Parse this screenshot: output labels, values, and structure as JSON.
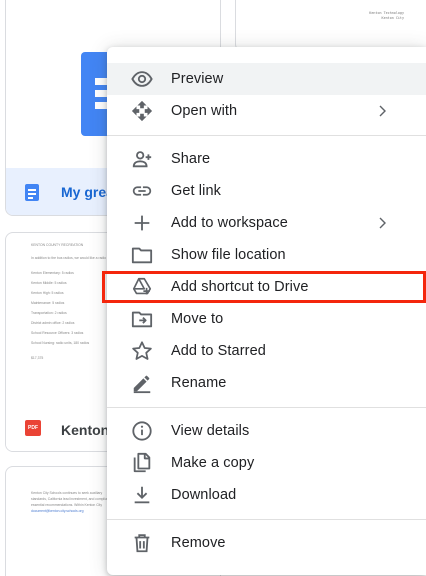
{
  "files": [
    {
      "title": "My grea",
      "type": "doc"
    },
    {
      "title": "Kenton S",
      "type": "pdf",
      "badge": "PDF"
    }
  ],
  "thumbnails": {
    "card2_lines": [
      "Kenton Technology",
      "Kenton City"
    ],
    "card3_lines": [
      "KENTON COUNTY RECREATION",
      "In addition to the bus radios, we would like a radio for",
      "Kenton Elementary: 5 radios",
      "Kenton Middle: 5 radios",
      "Kenton High: 5 radios",
      "Maintenance: 5 radios",
      "Transportation: 2 radios",
      "District admin office: 2 radios",
      "School Resource Officers: 3 radios",
      "School Nursing: radio units, 180 radios",
      "$17,375"
    ],
    "card4_lines": [
      "Kenton City Schools continues to seek auxiliary",
      "standards, California lead investment, and compliance",
      "essential recommendations. Within Kenton City",
      "document@kenton.city.schools.org"
    ]
  },
  "menu": {
    "items": [
      {
        "label": "Preview",
        "icon": "eye-icon",
        "submenu": false
      },
      {
        "label": "Open with",
        "icon": "open-with-icon",
        "submenu": true
      },
      {
        "label": "Share",
        "icon": "add-person-icon",
        "submenu": false
      },
      {
        "label": "Get link",
        "icon": "link-icon",
        "submenu": false
      },
      {
        "label": "Add to workspace",
        "icon": "plus-icon",
        "submenu": true
      },
      {
        "label": "Show file location",
        "icon": "folder-icon",
        "submenu": false
      },
      {
        "label": "Add shortcut to Drive",
        "icon": "drive-shortcut-icon",
        "submenu": false
      },
      {
        "label": "Move to",
        "icon": "move-to-folder-icon",
        "submenu": false
      },
      {
        "label": "Add to Starred",
        "icon": "star-icon",
        "submenu": false
      },
      {
        "label": "Rename",
        "icon": "rename-pencil-icon",
        "submenu": false
      },
      {
        "label": "View details",
        "icon": "info-icon",
        "submenu": false
      },
      {
        "label": "Make a copy",
        "icon": "copy-icon",
        "submenu": false
      },
      {
        "label": "Download",
        "icon": "download-icon",
        "submenu": false
      },
      {
        "label": "Remove",
        "icon": "trash-icon",
        "submenu": false
      }
    ],
    "hovered_item": "Preview",
    "highlighted_item": "Add shortcut to Drive"
  },
  "colors": {
    "highlight_border": "#f4260c",
    "doc_blue": "#4285f4",
    "pdf_red": "#ea4335",
    "selected_bg": "#e8f0fe"
  }
}
